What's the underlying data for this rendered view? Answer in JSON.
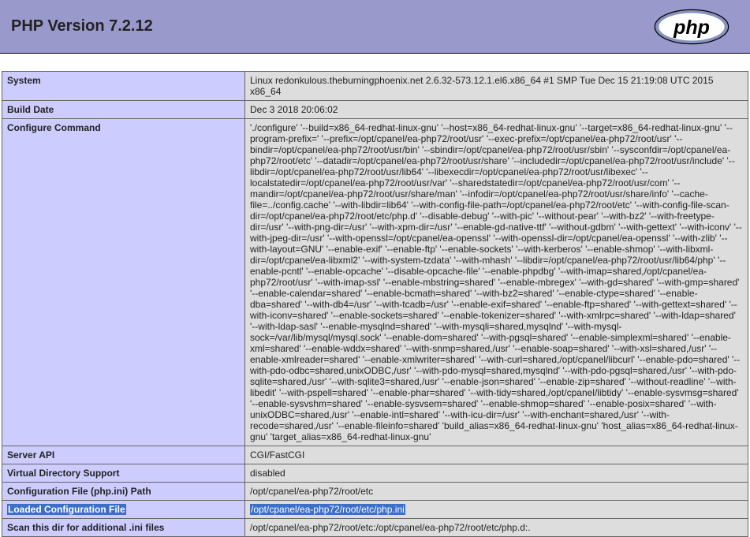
{
  "header": {
    "title": "PHP Version 7.2.12",
    "logo_alt": "php"
  },
  "rows": [
    {
      "label": "System",
      "value": "Linux redonkulous.theburningphoenix.net 2.6.32-573.12.1.el6.x86_64 #1 SMP Tue Dec 15 21:19:08 UTC 2015 x86_64"
    },
    {
      "label": "Build Date",
      "value": "Dec 3 2018 20:06:02"
    },
    {
      "label": "Configure Command",
      "value": "'./configure' '--build=x86_64-redhat-linux-gnu' '--host=x86_64-redhat-linux-gnu' '--target=x86_64-redhat-linux-gnu' '--program-prefix=' '--prefix=/opt/cpanel/ea-php72/root/usr' '--exec-prefix=/opt/cpanel/ea-php72/root/usr' '--bindir=/opt/cpanel/ea-php72/root/usr/bin' '--sbindir=/opt/cpanel/ea-php72/root/usr/sbin' '--sysconfdir=/opt/cpanel/ea-php72/root/etc' '--datadir=/opt/cpanel/ea-php72/root/usr/share' '--includedir=/opt/cpanel/ea-php72/root/usr/include' '--libdir=/opt/cpanel/ea-php72/root/usr/lib64' '--libexecdir=/opt/cpanel/ea-php72/root/usr/libexec' '--localstatedir=/opt/cpanel/ea-php72/root/usr/var' '--sharedstatedir=/opt/cpanel/ea-php72/root/usr/com' '--mandir=/opt/cpanel/ea-php72/root/usr/share/man' '--infodir=/opt/cpanel/ea-php72/root/usr/share/info' '--cache-file=../config.cache' '--with-libdir=lib64' '--with-config-file-path=/opt/cpanel/ea-php72/root/etc' '--with-config-file-scan-dir=/opt/cpanel/ea-php72/root/etc/php.d' '--disable-debug' '--with-pic' '--without-pear' '--with-bz2' '--with-freetype-dir=/usr' '--with-png-dir=/usr' '--with-xpm-dir=/usr' '--enable-gd-native-ttf' '--without-gdbm' '--with-gettext' '--with-iconv' '--with-jpeg-dir=/usr' '--with-openssl=/opt/cpanel/ea-openssl' '--with-openssl-dir=/opt/cpanel/ea-openssl' '--with-zlib' '--with-layout=GNU' '--enable-exif' '--enable-ftp' '--enable-sockets' '--with-kerberos' '--enable-shmop' '--with-libxml-dir=/opt/cpanel/ea-libxml2' '--with-system-tzdata' '--with-mhash' '--libdir=/opt/cpanel/ea-php72/root/usr/lib64/php' '--enable-pcntl' '--enable-opcache' '--disable-opcache-file' '--enable-phpdbg' '--with-imap=shared,/opt/cpanel/ea-php72/root/usr' '--with-imap-ssl' '--enable-mbstring=shared' '--enable-mbregex' '--with-gd=shared' '--with-gmp=shared' '--enable-calendar=shared' '--enable-bcmath=shared' '--with-bz2=shared' '--enable-ctype=shared' '--enable-dba=shared' '--with-db4=/usr' '--with-tcadb=/usr' '--enable-exif=shared' '--enable-ftp=shared' '--with-gettext=shared' '--with-iconv=shared' '--enable-sockets=shared' '--enable-tokenizer=shared' '--with-xmlrpc=shared' '--with-ldap=shared' '--with-ldap-sasl' '--enable-mysqlnd=shared' '--with-mysqli=shared,mysqlnd' '--with-mysql-sock=/var/lib/mysql/mysql.sock' '--enable-dom=shared' '--with-pgsql=shared' '--enable-simplexml=shared' '--enable-xml=shared' '--enable-wddx=shared' '--with-snmp=shared,/usr' '--enable-soap=shared' '--with-xsl=shared,/usr' '--enable-xmlreader=shared' '--enable-xmlwriter=shared' '--with-curl=shared,/opt/cpanel/libcurl' '--enable-pdo=shared' '--with-pdo-odbc=shared,unixODBC,/usr' '--with-pdo-mysql=shared,mysqlnd' '--with-pdo-pgsql=shared,/usr' '--with-pdo-sqlite=shared,/usr' '--with-sqlite3=shared,/usr' '--enable-json=shared' '--enable-zip=shared' '--without-readline' '--with-libedit' '--with-pspell=shared' '--enable-phar=shared' '--with-tidy=shared,/opt/cpanel/libtidy' '--enable-sysvmsg=shared' '--enable-sysvshm=shared' '--enable-sysvsem=shared' '--enable-shmop=shared' '--enable-posix=shared' '--with-unixODBC=shared,/usr' '--enable-intl=shared' '--with-icu-dir=/usr' '--with-enchant=shared,/usr' '--with-recode=shared,/usr' '--enable-fileinfo=shared' 'build_alias=x86_64-redhat-linux-gnu' 'host_alias=x86_64-redhat-linux-gnu' 'target_alias=x86_64-redhat-linux-gnu'"
    },
    {
      "label": "Server API",
      "value": "CGI/FastCGI"
    },
    {
      "label": "Virtual Directory Support",
      "value": "disabled"
    },
    {
      "label": "Configuration File (php.ini) Path",
      "value": "/opt/cpanel/ea-php72/root/etc"
    },
    {
      "label": "Loaded Configuration File",
      "value": "/opt/cpanel/ea-php72/root/etc/php.ini",
      "selected": true
    },
    {
      "label": "Scan this dir for additional .ini files",
      "value": "/opt/cpanel/ea-php72/root/etc:/opt/cpanel/ea-php72/root/etc/php.d:."
    }
  ]
}
